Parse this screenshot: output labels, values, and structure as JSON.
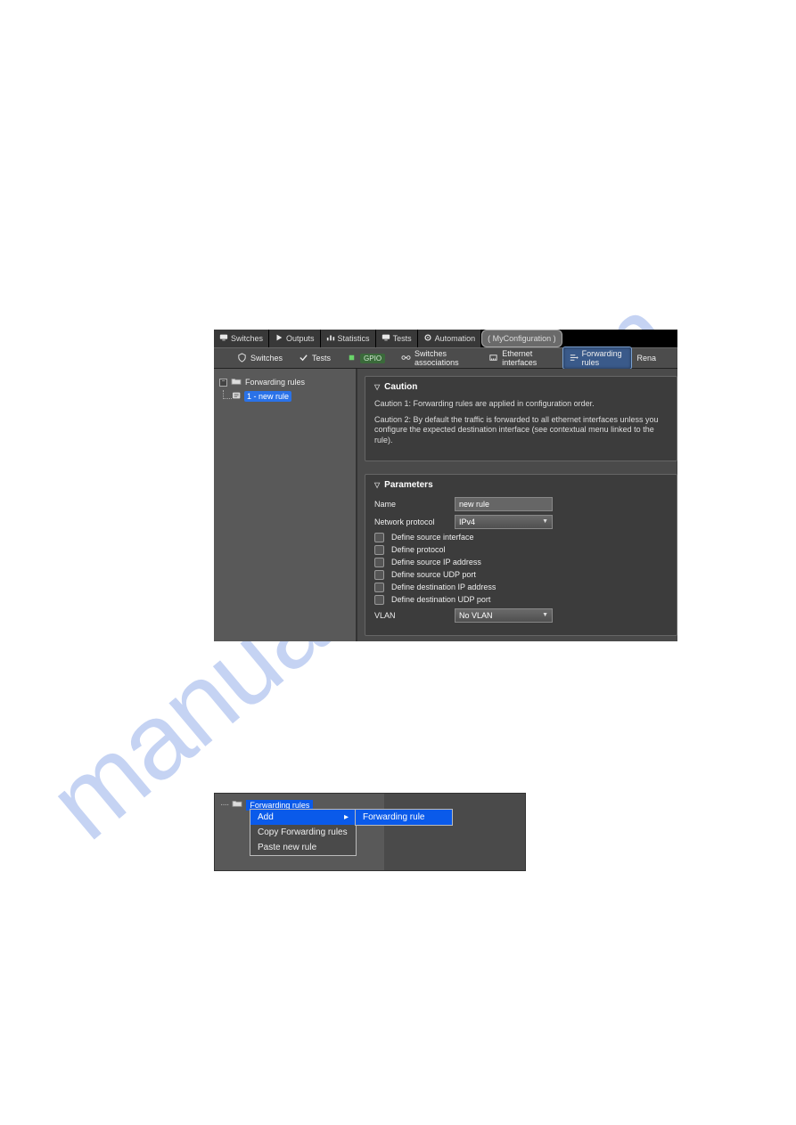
{
  "tabs": {
    "switches": "Switches",
    "outputs": "Outputs",
    "statistics": "Statistics",
    "tests": "Tests",
    "automation": "Automation",
    "myconfig": "( MyConfiguration )"
  },
  "toolbar": {
    "switches": "Switches",
    "tests": "Tests",
    "gpio": "GPIO",
    "associations": "Switches associations",
    "ethernet": "Ethernet interfaces",
    "forwarding": "Forwarding rules",
    "rena": "Rena"
  },
  "tree1": {
    "root": "Forwarding rules",
    "child": "1 - new rule"
  },
  "caution": {
    "title": "Caution",
    "line1": "Caution 1: Forwarding rules are applied in configuration order.",
    "line2": "Caution 2: By default the traffic is forwarded to all ethernet interfaces unless you configure the expected destination interface (see contextual menu linked to the rule)."
  },
  "params": {
    "title": "Parameters",
    "name_label": "Name",
    "name_value": "new rule",
    "protocol_label": "Network protocol",
    "protocol_value": "IPv4",
    "cb_src_iface": "Define source interface",
    "cb_protocol": "Define protocol",
    "cb_src_ip": "Define source IP address",
    "cb_src_udp": "Define source UDP port",
    "cb_dst_ip": "Define destination IP address",
    "cb_dst_udp": "Define destination UDP port",
    "vlan_label": "VLAN",
    "vlan_value": "No VLAN"
  },
  "tree2": {
    "root": "Forwarding rules"
  },
  "contextmenu": {
    "add": "Add",
    "copy": "Copy Forwarding rules",
    "paste": "Paste new rule",
    "submenu_forwarding": "Forwarding rule"
  },
  "watermark": "manualslive.com"
}
